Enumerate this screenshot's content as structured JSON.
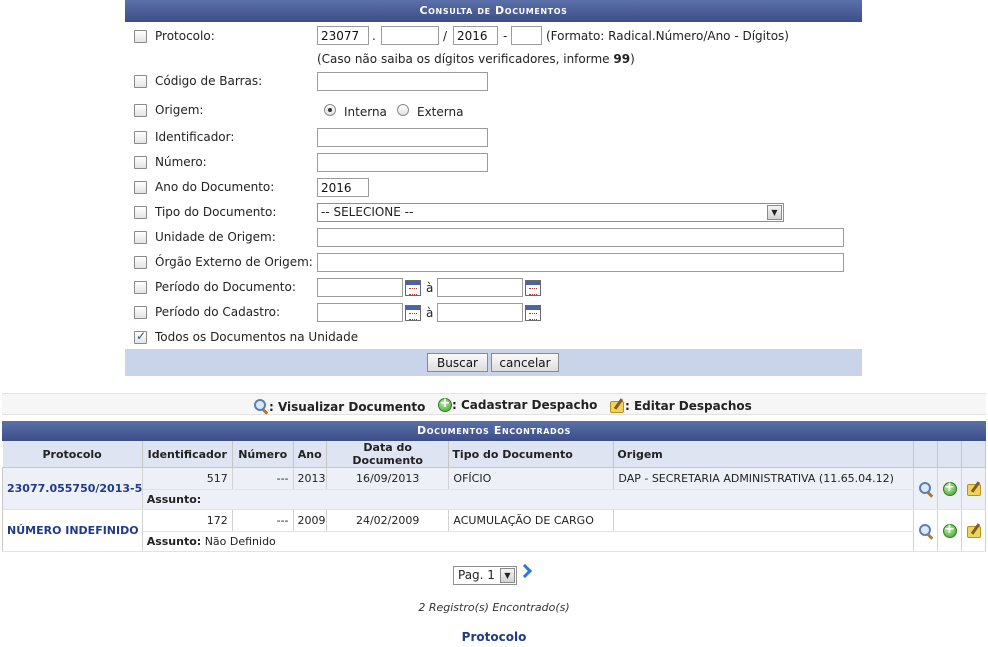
{
  "form": {
    "title": "Consulta de Documentos",
    "protocolo": {
      "label": "Protocolo:",
      "radical": "23077",
      "numero": "",
      "ano": "2016",
      "digitos": "",
      "sep1": ".",
      "sep2": "/",
      "sep3": "-",
      "format_hint": "(Formato: Radical.Número/Ano - Dígitos)",
      "help_text": "(Caso não saiba os dígitos verificadores, informe ",
      "help_bold": "99",
      "help_end": ")"
    },
    "codigo_barras": {
      "label": "Código de Barras:",
      "value": ""
    },
    "origem": {
      "label": "Origem:",
      "option_interna": "Interna",
      "option_externa": "Externa",
      "selected": "Interna"
    },
    "identificador": {
      "label": "Identificador:",
      "value": ""
    },
    "numero": {
      "label": "Número:",
      "value": ""
    },
    "ano_documento": {
      "label": "Ano do Documento:",
      "value": "2016"
    },
    "tipo_documento": {
      "label": "Tipo do Documento:",
      "value": "-- SELECIONE --"
    },
    "unidade_origem": {
      "label": "Unidade de Origem:",
      "value": ""
    },
    "orgao_externo": {
      "label": "Órgão Externo de Origem:",
      "value": ""
    },
    "periodo_documento": {
      "label": "Período do Documento:",
      "from": "",
      "to": "",
      "sep": "à"
    },
    "periodo_cadastro": {
      "label": "Período do Cadastro:",
      "from": "",
      "to": "",
      "sep": "à"
    },
    "todos_documentos": {
      "label": "Todos os Documentos na Unidade",
      "checked": true
    },
    "buttons": {
      "buscar": "Buscar",
      "cancelar": "cancelar"
    }
  },
  "legend": {
    "visualizar": ": Visualizar Documento",
    "cadastrar": ": Cadastrar Despacho",
    "editar": ": Editar Despachos"
  },
  "results": {
    "title": "Documentos Encontrados",
    "columns": [
      "Protocolo",
      "Identificador",
      "Número",
      "Ano",
      "Data do Documento",
      "Tipo do Documento",
      "Origem"
    ],
    "assunto_label": "Assunto:",
    "rows": [
      {
        "protocolo": "23077.055750/2013-53",
        "identificador": "517",
        "numero": "---",
        "ano": "2013",
        "data": "16/09/2013",
        "tipo": "OFÍCIO",
        "origem": "DAP - SECRETARIA ADMINISTRATIVA (11.65.04.12)",
        "assunto": ""
      },
      {
        "protocolo": "NÚMERO INDEFINIDO",
        "identificador": "172",
        "numero": "---",
        "ano": "2009",
        "data": "24/02/2009",
        "tipo": "ACUMULAÇÃO DE CARGO",
        "origem": "",
        "assunto": "Não Definido"
      }
    ]
  },
  "pagination": {
    "page": "Pag. 1"
  },
  "count_text": "2 Registro(s) Encontrado(s)",
  "bottom_link": "Protocolo"
}
